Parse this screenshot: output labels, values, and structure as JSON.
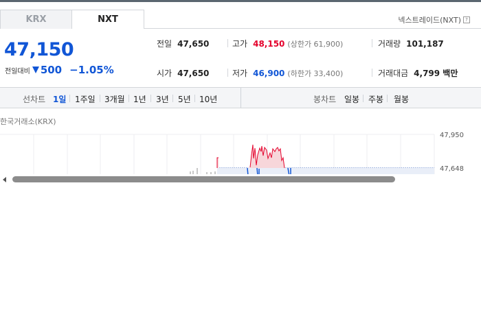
{
  "tabs": [
    {
      "label": "KRX",
      "active": false
    },
    {
      "label": "NXT",
      "active": true
    }
  ],
  "nxt_link": {
    "label": "넥스트레이드(NXT)",
    "help_icon": "help-question-icon"
  },
  "price": {
    "current": "47,150",
    "change_label": "전일대비",
    "change_icon": "down-triangle-icon",
    "change_value": "500",
    "change_rate": "−1.05%",
    "color": "#1156d6"
  },
  "stats": {
    "prev_close": {
      "label": "전일",
      "value": "47,650"
    },
    "high": {
      "label": "고가",
      "value": "48,150",
      "sub": "(상한가 61,900)"
    },
    "volume": {
      "label": "거래량",
      "value": "101,187"
    },
    "open": {
      "label": "시가",
      "value": "47,650"
    },
    "low": {
      "label": "저가",
      "value": "46,900",
      "sub": "(하한가 33,400)"
    },
    "amount": {
      "label": "거래대금",
      "value": "4,799 백만"
    }
  },
  "toolbar": {
    "line_chart_label": "선차트",
    "periods": [
      "1일",
      "1주일",
      "3개월",
      "1년",
      "3년",
      "5년",
      "10년"
    ],
    "active_period": "1일",
    "candle_chart_label": "봉차트",
    "candle_periods": [
      "일봉",
      "주봉",
      "월봉"
    ]
  },
  "chart": {
    "title": "한국거래소(KRX)",
    "y_labels": [
      "47,950",
      "47,648"
    ],
    "up_color": "#e4002b",
    "down_color": "#1156d6"
  }
}
